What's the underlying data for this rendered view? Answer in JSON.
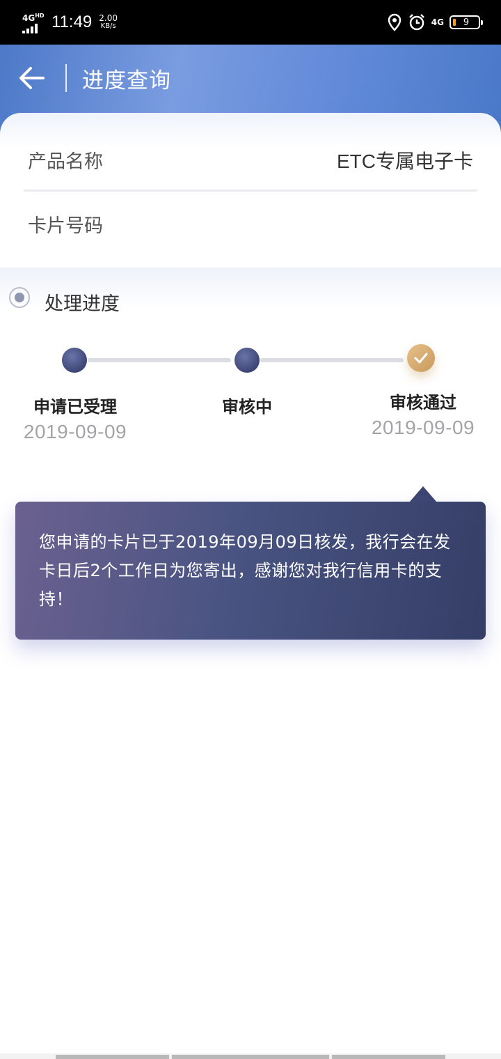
{
  "status_bar": {
    "network": "4G",
    "network_hd": "HD",
    "time": "11:49",
    "speed_value": "2.00",
    "speed_unit": "KB/s",
    "network_right": "4G",
    "battery": "9"
  },
  "header": {
    "title": "进度查询"
  },
  "info": {
    "product_label": "产品名称",
    "product_value": "ETC专属电子卡",
    "card_label": "卡片号码"
  },
  "progress": {
    "section_title": "处理进度",
    "steps": [
      {
        "label": "申请已受理",
        "date": "2019-09-09",
        "status": "done"
      },
      {
        "label": "审核中",
        "date": "",
        "status": "done"
      },
      {
        "label": "审核通过",
        "date": "2019-09-09",
        "status": "current"
      }
    ],
    "message": "您申请的卡片已于2019年09月09日核发，我行会在发卡日后2个工作日为您寄出，感谢您对我行信用卡的支持！"
  },
  "colors": {
    "header_blue": "#5f88d8",
    "dot_navy": "#3d4676",
    "done_gold": "#c99a5c"
  },
  "icons": {
    "back": "arrow-left-icon",
    "location": "location-pin-icon",
    "alarm": "alarm-clock-icon",
    "check": "check-icon",
    "radio": "radio-icon"
  }
}
